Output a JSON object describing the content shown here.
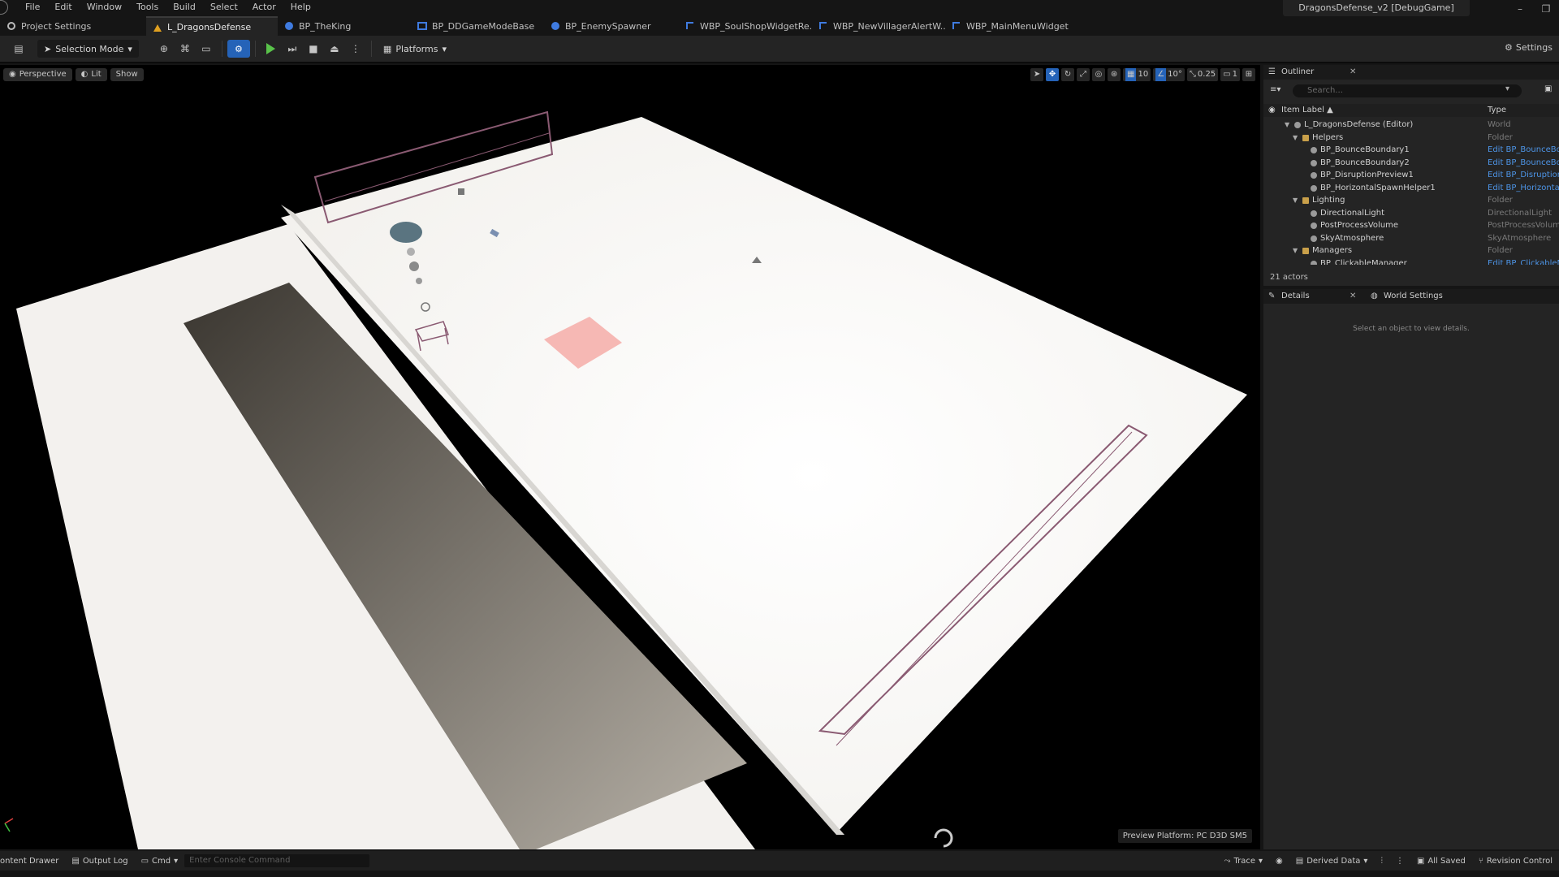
{
  "menu": [
    "File",
    "Edit",
    "Window",
    "Tools",
    "Build",
    "Select",
    "Actor",
    "Help"
  ],
  "window_title": "DragonsDefense_v2 [DebugGame]",
  "tabs": [
    {
      "label": "Project Settings"
    },
    {
      "label": "L_DragonsDefense"
    },
    {
      "label": "BP_TheKing"
    },
    {
      "label": "BP_DDGameModeBase"
    },
    {
      "label": "BP_EnemySpawner"
    },
    {
      "label": "WBP_SoulShopWidgetRe..."
    },
    {
      "label": "WBP_NewVillagerAlertW..."
    },
    {
      "label": "WBP_MainMenuWidget"
    }
  ],
  "toolbar": {
    "selection_mode": "Selection Mode",
    "platforms": "Platforms",
    "settings": "Settings"
  },
  "viewport": {
    "perspective": "Perspective",
    "lit": "Lit",
    "show": "Show",
    "grid_snap": "10",
    "rotation_snap": "10°",
    "scale_snap": "0.25",
    "camera_speed": "1",
    "preview_platform": "Preview Platform: PC D3D SM5"
  },
  "outliner": {
    "title": "Outliner",
    "search_placeholder": "Search...",
    "col_label": "Item Label ▲",
    "col_type": "Type",
    "rows": [
      {
        "label": "L_DragonsDefense (Editor)",
        "type": "World",
        "indent": 0,
        "link": false,
        "folder": false,
        "expanded": true
      },
      {
        "label": "Helpers",
        "type": "Folder",
        "indent": 1,
        "link": false,
        "folder": true,
        "expanded": true
      },
      {
        "label": "BP_BounceBoundary1",
        "type": "Edit BP_BounceBou",
        "indent": 2,
        "link": true,
        "folder": false
      },
      {
        "label": "BP_BounceBoundary2",
        "type": "Edit BP_BounceBou",
        "indent": 2,
        "link": true,
        "folder": false
      },
      {
        "label": "BP_DisruptionPreview1",
        "type": "Edit BP_DisruptionP",
        "indent": 2,
        "link": true,
        "folder": false
      },
      {
        "label": "BP_HorizontalSpawnHelper1",
        "type": "Edit BP_HorizontalS",
        "indent": 2,
        "link": true,
        "folder": false
      },
      {
        "label": "Lighting",
        "type": "Folder",
        "indent": 1,
        "link": false,
        "folder": true,
        "expanded": true
      },
      {
        "label": "DirectionalLight",
        "type": "DirectionalLight",
        "indent": 2,
        "link": false,
        "folder": false
      },
      {
        "label": "PostProcessVolume",
        "type": "PostProcessVolum",
        "indent": 2,
        "link": false,
        "folder": false
      },
      {
        "label": "SkyAtmosphere",
        "type": "SkyAtmosphere",
        "indent": 2,
        "link": false,
        "folder": false
      },
      {
        "label": "Managers",
        "type": "Folder",
        "indent": 1,
        "link": false,
        "folder": true,
        "expanded": true
      },
      {
        "label": "BP_ClickableManager",
        "type": "Edit BP_ClickableM",
        "indent": 2,
        "link": true,
        "folder": false
      }
    ],
    "actor_count": "21 actors"
  },
  "details": {
    "title": "Details",
    "world_settings": "World Settings",
    "empty": "Select an object to view details."
  },
  "statusbar": {
    "content_drawer": "ontent Drawer",
    "output_log": "Output Log",
    "cmd": "Cmd",
    "console_placeholder": "Enter Console Command",
    "trace": "Trace",
    "derived_data": "Derived Data",
    "all_saved": "All Saved",
    "revision_control": "Revision Control"
  },
  "colors": {
    "accent": "#2563b8",
    "play": "#59c34a",
    "link": "#4d94e6",
    "panel": "#242424"
  }
}
